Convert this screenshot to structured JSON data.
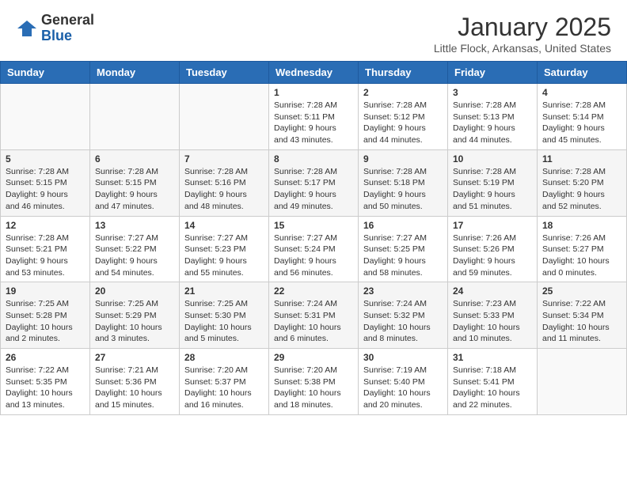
{
  "header": {
    "logo_general": "General",
    "logo_blue": "Blue",
    "month_title": "January 2025",
    "location": "Little Flock, Arkansas, United States"
  },
  "days_of_week": [
    "Sunday",
    "Monday",
    "Tuesday",
    "Wednesday",
    "Thursday",
    "Friday",
    "Saturday"
  ],
  "weeks": [
    [
      {
        "num": "",
        "info": ""
      },
      {
        "num": "",
        "info": ""
      },
      {
        "num": "",
        "info": ""
      },
      {
        "num": "1",
        "info": "Sunrise: 7:28 AM\nSunset: 5:11 PM\nDaylight: 9 hours\nand 43 minutes."
      },
      {
        "num": "2",
        "info": "Sunrise: 7:28 AM\nSunset: 5:12 PM\nDaylight: 9 hours\nand 44 minutes."
      },
      {
        "num": "3",
        "info": "Sunrise: 7:28 AM\nSunset: 5:13 PM\nDaylight: 9 hours\nand 44 minutes."
      },
      {
        "num": "4",
        "info": "Sunrise: 7:28 AM\nSunset: 5:14 PM\nDaylight: 9 hours\nand 45 minutes."
      }
    ],
    [
      {
        "num": "5",
        "info": "Sunrise: 7:28 AM\nSunset: 5:15 PM\nDaylight: 9 hours\nand 46 minutes."
      },
      {
        "num": "6",
        "info": "Sunrise: 7:28 AM\nSunset: 5:15 PM\nDaylight: 9 hours\nand 47 minutes."
      },
      {
        "num": "7",
        "info": "Sunrise: 7:28 AM\nSunset: 5:16 PM\nDaylight: 9 hours\nand 48 minutes."
      },
      {
        "num": "8",
        "info": "Sunrise: 7:28 AM\nSunset: 5:17 PM\nDaylight: 9 hours\nand 49 minutes."
      },
      {
        "num": "9",
        "info": "Sunrise: 7:28 AM\nSunset: 5:18 PM\nDaylight: 9 hours\nand 50 minutes."
      },
      {
        "num": "10",
        "info": "Sunrise: 7:28 AM\nSunset: 5:19 PM\nDaylight: 9 hours\nand 51 minutes."
      },
      {
        "num": "11",
        "info": "Sunrise: 7:28 AM\nSunset: 5:20 PM\nDaylight: 9 hours\nand 52 minutes."
      }
    ],
    [
      {
        "num": "12",
        "info": "Sunrise: 7:28 AM\nSunset: 5:21 PM\nDaylight: 9 hours\nand 53 minutes."
      },
      {
        "num": "13",
        "info": "Sunrise: 7:27 AM\nSunset: 5:22 PM\nDaylight: 9 hours\nand 54 minutes."
      },
      {
        "num": "14",
        "info": "Sunrise: 7:27 AM\nSunset: 5:23 PM\nDaylight: 9 hours\nand 55 minutes."
      },
      {
        "num": "15",
        "info": "Sunrise: 7:27 AM\nSunset: 5:24 PM\nDaylight: 9 hours\nand 56 minutes."
      },
      {
        "num": "16",
        "info": "Sunrise: 7:27 AM\nSunset: 5:25 PM\nDaylight: 9 hours\nand 58 minutes."
      },
      {
        "num": "17",
        "info": "Sunrise: 7:26 AM\nSunset: 5:26 PM\nDaylight: 9 hours\nand 59 minutes."
      },
      {
        "num": "18",
        "info": "Sunrise: 7:26 AM\nSunset: 5:27 PM\nDaylight: 10 hours\nand 0 minutes."
      }
    ],
    [
      {
        "num": "19",
        "info": "Sunrise: 7:25 AM\nSunset: 5:28 PM\nDaylight: 10 hours\nand 2 minutes."
      },
      {
        "num": "20",
        "info": "Sunrise: 7:25 AM\nSunset: 5:29 PM\nDaylight: 10 hours\nand 3 minutes."
      },
      {
        "num": "21",
        "info": "Sunrise: 7:25 AM\nSunset: 5:30 PM\nDaylight: 10 hours\nand 5 minutes."
      },
      {
        "num": "22",
        "info": "Sunrise: 7:24 AM\nSunset: 5:31 PM\nDaylight: 10 hours\nand 6 minutes."
      },
      {
        "num": "23",
        "info": "Sunrise: 7:24 AM\nSunset: 5:32 PM\nDaylight: 10 hours\nand 8 minutes."
      },
      {
        "num": "24",
        "info": "Sunrise: 7:23 AM\nSunset: 5:33 PM\nDaylight: 10 hours\nand 10 minutes."
      },
      {
        "num": "25",
        "info": "Sunrise: 7:22 AM\nSunset: 5:34 PM\nDaylight: 10 hours\nand 11 minutes."
      }
    ],
    [
      {
        "num": "26",
        "info": "Sunrise: 7:22 AM\nSunset: 5:35 PM\nDaylight: 10 hours\nand 13 minutes."
      },
      {
        "num": "27",
        "info": "Sunrise: 7:21 AM\nSunset: 5:36 PM\nDaylight: 10 hours\nand 15 minutes."
      },
      {
        "num": "28",
        "info": "Sunrise: 7:20 AM\nSunset: 5:37 PM\nDaylight: 10 hours\nand 16 minutes."
      },
      {
        "num": "29",
        "info": "Sunrise: 7:20 AM\nSunset: 5:38 PM\nDaylight: 10 hours\nand 18 minutes."
      },
      {
        "num": "30",
        "info": "Sunrise: 7:19 AM\nSunset: 5:40 PM\nDaylight: 10 hours\nand 20 minutes."
      },
      {
        "num": "31",
        "info": "Sunrise: 7:18 AM\nSunset: 5:41 PM\nDaylight: 10 hours\nand 22 minutes."
      },
      {
        "num": "",
        "info": ""
      }
    ]
  ]
}
